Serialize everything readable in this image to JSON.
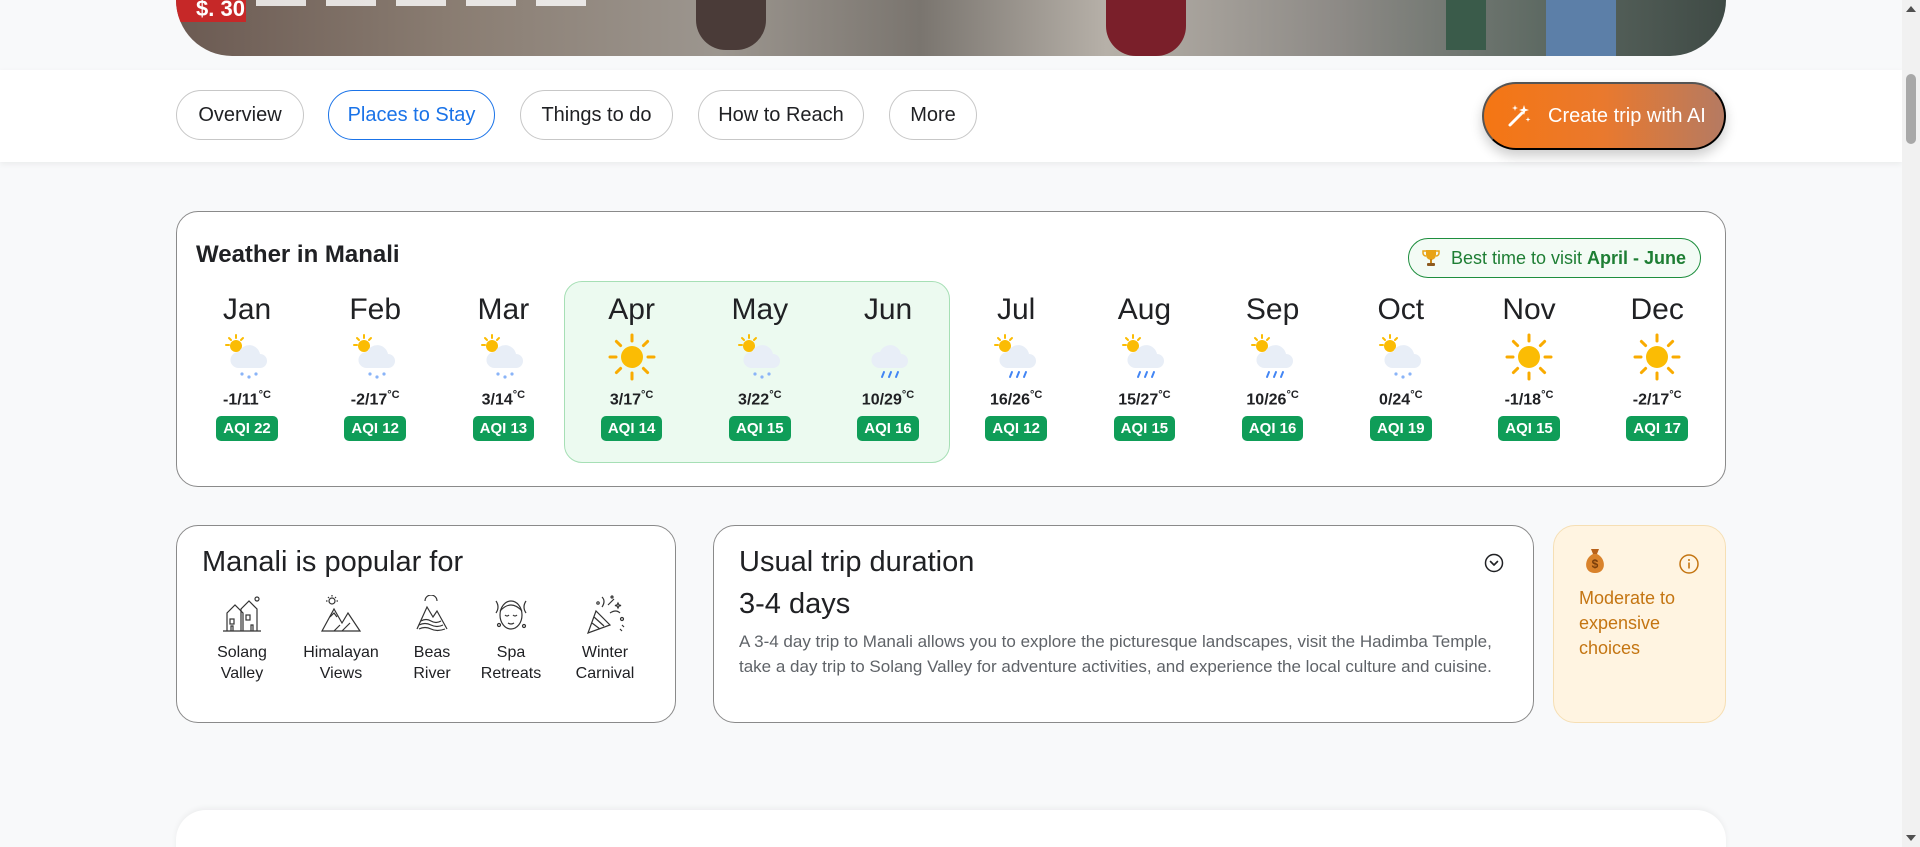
{
  "hero": {
    "sign_text": "$. 30"
  },
  "nav": {
    "tabs": [
      {
        "label": "Overview"
      },
      {
        "label": "Places to Stay"
      },
      {
        "label": "Things to do"
      },
      {
        "label": "How to Reach"
      },
      {
        "label": "More"
      }
    ],
    "active_tab": "Places to Stay",
    "cta_label": "Create trip with AI",
    "cta_icon": "magic-wand-icon"
  },
  "weather": {
    "title": "Weather in Manali",
    "best_time_prefix": "Best time to visit",
    "best_time_range": "April - June",
    "best_time_icon": "trophy-icon",
    "unit": "°C",
    "months": [
      {
        "name": "Jan",
        "temp": "-1/11",
        "aqi": "AQI 22",
        "icon": "sun-snow-cloud-icon"
      },
      {
        "name": "Feb",
        "temp": "-2/17",
        "aqi": "AQI 12",
        "icon": "sun-snow-cloud-icon"
      },
      {
        "name": "Mar",
        "temp": "3/14",
        "aqi": "AQI 13",
        "icon": "sun-snow-cloud-icon"
      },
      {
        "name": "Apr",
        "temp": "3/17",
        "aqi": "AQI 14",
        "icon": "sun-icon"
      },
      {
        "name": "May",
        "temp": "3/22",
        "aqi": "AQI 15",
        "icon": "sun-snow-cloud-icon"
      },
      {
        "name": "Jun",
        "temp": "10/29",
        "aqi": "AQI 16",
        "icon": "rain-cloud-icon"
      },
      {
        "name": "Jul",
        "temp": "16/26",
        "aqi": "AQI 12",
        "icon": "sun-rain-cloud-icon"
      },
      {
        "name": "Aug",
        "temp": "15/27",
        "aqi": "AQI 15",
        "icon": "sun-rain-cloud-icon"
      },
      {
        "name": "Sep",
        "temp": "10/26",
        "aqi": "AQI 16",
        "icon": "sun-rain-cloud-icon"
      },
      {
        "name": "Oct",
        "temp": "0/24",
        "aqi": "AQI 19",
        "icon": "sun-snow-cloud-icon"
      },
      {
        "name": "Nov",
        "temp": "-1/18",
        "aqi": "AQI 15",
        "icon": "sun-icon"
      },
      {
        "name": "Dec",
        "temp": "-2/17",
        "aqi": "AQI 17",
        "icon": "sun-icon"
      }
    ],
    "colors": {
      "aqi_badge": "#0f9d58",
      "highlight_bg": "#ecfaf0",
      "highlight_border": "#a6dfb5",
      "best_time_text": "#1e7e34"
    }
  },
  "popular": {
    "title": "Manali is popular for",
    "items": [
      {
        "label_line1": "Solang",
        "label_line2": "Valley",
        "icon": "valley-houses-icon"
      },
      {
        "label_line1": "Himalayan",
        "label_line2": "Views",
        "icon": "mountains-icon"
      },
      {
        "label_line1": "Beas",
        "label_line2": "River",
        "icon": "river-icon"
      },
      {
        "label_line1": "Spa",
        "label_line2": "Retreats",
        "icon": "spa-face-icon"
      },
      {
        "label_line1": "Winter",
        "label_line2": "Carnival",
        "icon": "party-popper-icon"
      }
    ]
  },
  "duration": {
    "title": "Usual trip duration",
    "days": "3-4 days",
    "description": "A 3-4 day trip to Manali allows you to explore the picturesque landscapes, visit the Hadimba Temple, take a day trip to Solang Valley for adventure activities, and experience the local culture and cuisine.",
    "toggle_icon": "chevron-down-circle-icon"
  },
  "budget": {
    "text": "Moderate to expensive choices",
    "icon": "money-bag-icon",
    "info_icon": "info-icon",
    "colors": {
      "bg": "#fff4e1",
      "text": "#c47512"
    }
  },
  "brand_colors": {
    "active_tab": "#1a73e8",
    "cta_start": "#f57613",
    "cta_end": "#b57a62"
  }
}
